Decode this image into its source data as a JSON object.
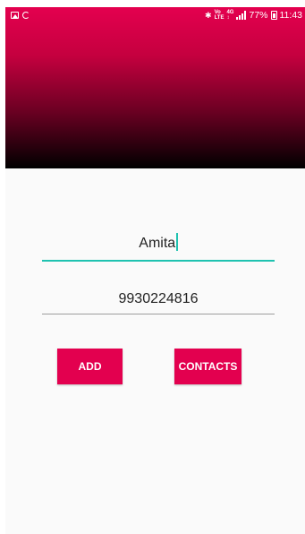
{
  "status_bar": {
    "battery_percent": "77%",
    "time": "11:43",
    "network_label": "4G",
    "volte_label": "VoLTE",
    "icons": [
      "gallery-icon",
      "sync-icon",
      "bluetooth-icon",
      "volte-icon",
      "signal-icon",
      "battery-icon"
    ]
  },
  "form": {
    "name_value": "Amita",
    "phone_value": "9930224816"
  },
  "buttons": {
    "add_label": "ADD",
    "contacts_label": "CONTACTS"
  },
  "colors": {
    "accent": "#e3004f",
    "focus_underline": "#1fc2b0",
    "header_gradient_top": "#e4004f",
    "header_gradient_bottom": "#000000"
  }
}
